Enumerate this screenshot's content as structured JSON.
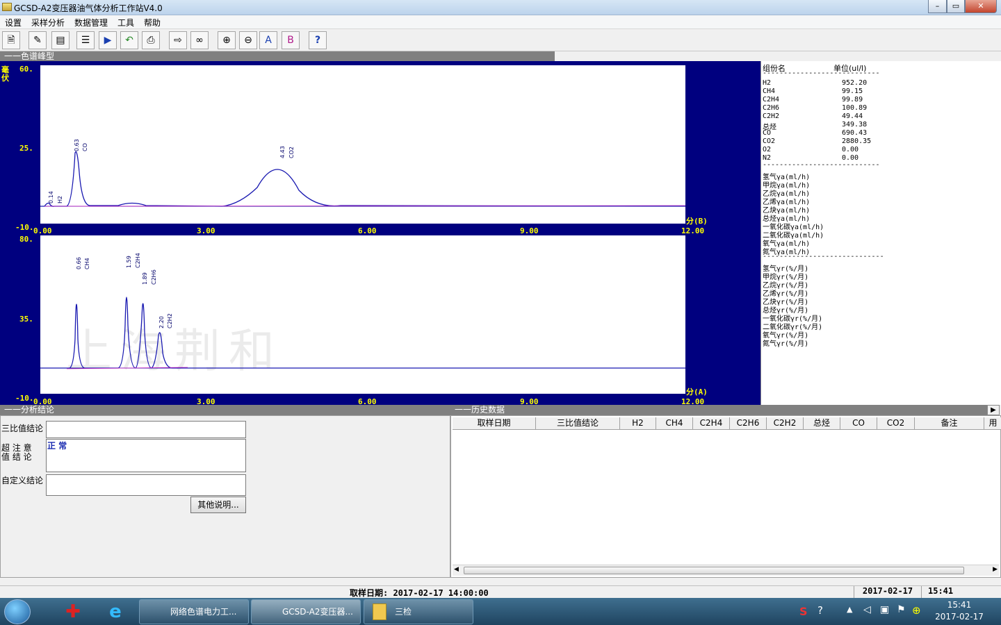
{
  "window": {
    "title": "GCSD-A2变压器油气体分析工作站V4.0"
  },
  "menu": [
    "设置",
    "采样分析",
    "数据管理",
    "工具",
    "帮助"
  ],
  "toolbar": {
    "help_label": "?"
  },
  "chrom_panel": {
    "header": "一一色谱峰型",
    "ylabel": "毫伏",
    "top": {
      "y_ticks": [
        "60.",
        "25.",
        "-10."
      ],
      "x_ticks": [
        "0.00",
        "3.00",
        "6.00",
        "9.00",
        "12.00"
      ],
      "unit_label": "分(B)",
      "peaks": [
        {
          "time": "0.14",
          "name": "H2"
        },
        {
          "time": "0.63",
          "name": "CO"
        },
        {
          "time": "4.43",
          "name": "CO2"
        }
      ]
    },
    "bottom": {
      "y_ticks": [
        "80.",
        "35.",
        "-10."
      ],
      "x_ticks": [
        "0.00",
        "3.00",
        "6.00",
        "9.00",
        "12.00"
      ],
      "unit_label": "分(A)",
      "peaks": [
        {
          "time": "0.66",
          "name": "CH4"
        },
        {
          "time": "1.59",
          "name": "C2H4"
        },
        {
          "time": "1.89",
          "name": "C2H6"
        },
        {
          "time": "2.20",
          "name": "C2H2"
        }
      ]
    },
    "watermark": "上海荆和"
  },
  "results": {
    "col_name": "组份名",
    "col_unit": "单位(ul/l)",
    "sep1": "----------------------------",
    "rows": [
      {
        "name": "H2",
        "value": "952.20"
      },
      {
        "name": "CH4",
        "value": "99.15"
      },
      {
        "name": "C2H4",
        "value": "99.89"
      },
      {
        "name": "C2H6",
        "value": "100.89"
      },
      {
        "name": "C2H2",
        "value": "49.44"
      },
      {
        "name": "总烃",
        "value": "349.38"
      },
      {
        "name": "CO",
        "value": "690.43"
      },
      {
        "name": "CO2",
        "value": "2880.35"
      },
      {
        "name": "O2",
        "value": "0.00"
      },
      {
        "name": "N2",
        "value": "0.00"
      }
    ],
    "sep2": "----------------------------",
    "rates_a": [
      "氢气γa(ml/h)",
      "甲烷γa(ml/h)",
      "乙烷γa(ml/h)",
      "乙烯γa(ml/h)",
      "乙炔γa(ml/h)",
      "总烃γa(ml/h)",
      "一氧化碳γa(ml/h)",
      "二氧化碳γa(ml/h)",
      "氧气γa(ml/h)",
      "氮气γa(ml/h)"
    ],
    "sep3": "-----------------------------",
    "rates_r": [
      "氢气γr(%/月)",
      "甲烷γr(%/月)",
      "乙烷γr(%/月)",
      "乙烯γr(%/月)",
      "乙炔γr(%/月)",
      "总烃γr(%/月)",
      "一氧化碳γr(%/月)",
      "二氧化碳γr(%/月)",
      "氧气γr(%/月)",
      "氮气γr(%/月)"
    ]
  },
  "conclusion": {
    "header": "一一分析结论",
    "ratio_label": "三比值结论",
    "attention_label": "超 注 意\n值 结 论",
    "attention_value": "正 常",
    "custom_label": "自定义结论",
    "other_button": "其他说明..."
  },
  "history": {
    "header": "一一历史数据",
    "columns": [
      "取样日期",
      "三比值结论",
      "H2",
      "CH4",
      "C2H4",
      "C2H6",
      "C2H2",
      "总烃",
      "CO",
      "CO2",
      "备注",
      "用"
    ]
  },
  "statusbar": {
    "sample_date": "取样日期: 2017-02-17 14:00:00",
    "date": "2017-02-17",
    "time": "15:41"
  },
  "taskbar": {
    "items": [
      "网络色谱电力工...",
      "GCSD-A2变压器...",
      "三检"
    ],
    "clock_time": "15:41",
    "clock_date": "2017-02-17"
  }
}
